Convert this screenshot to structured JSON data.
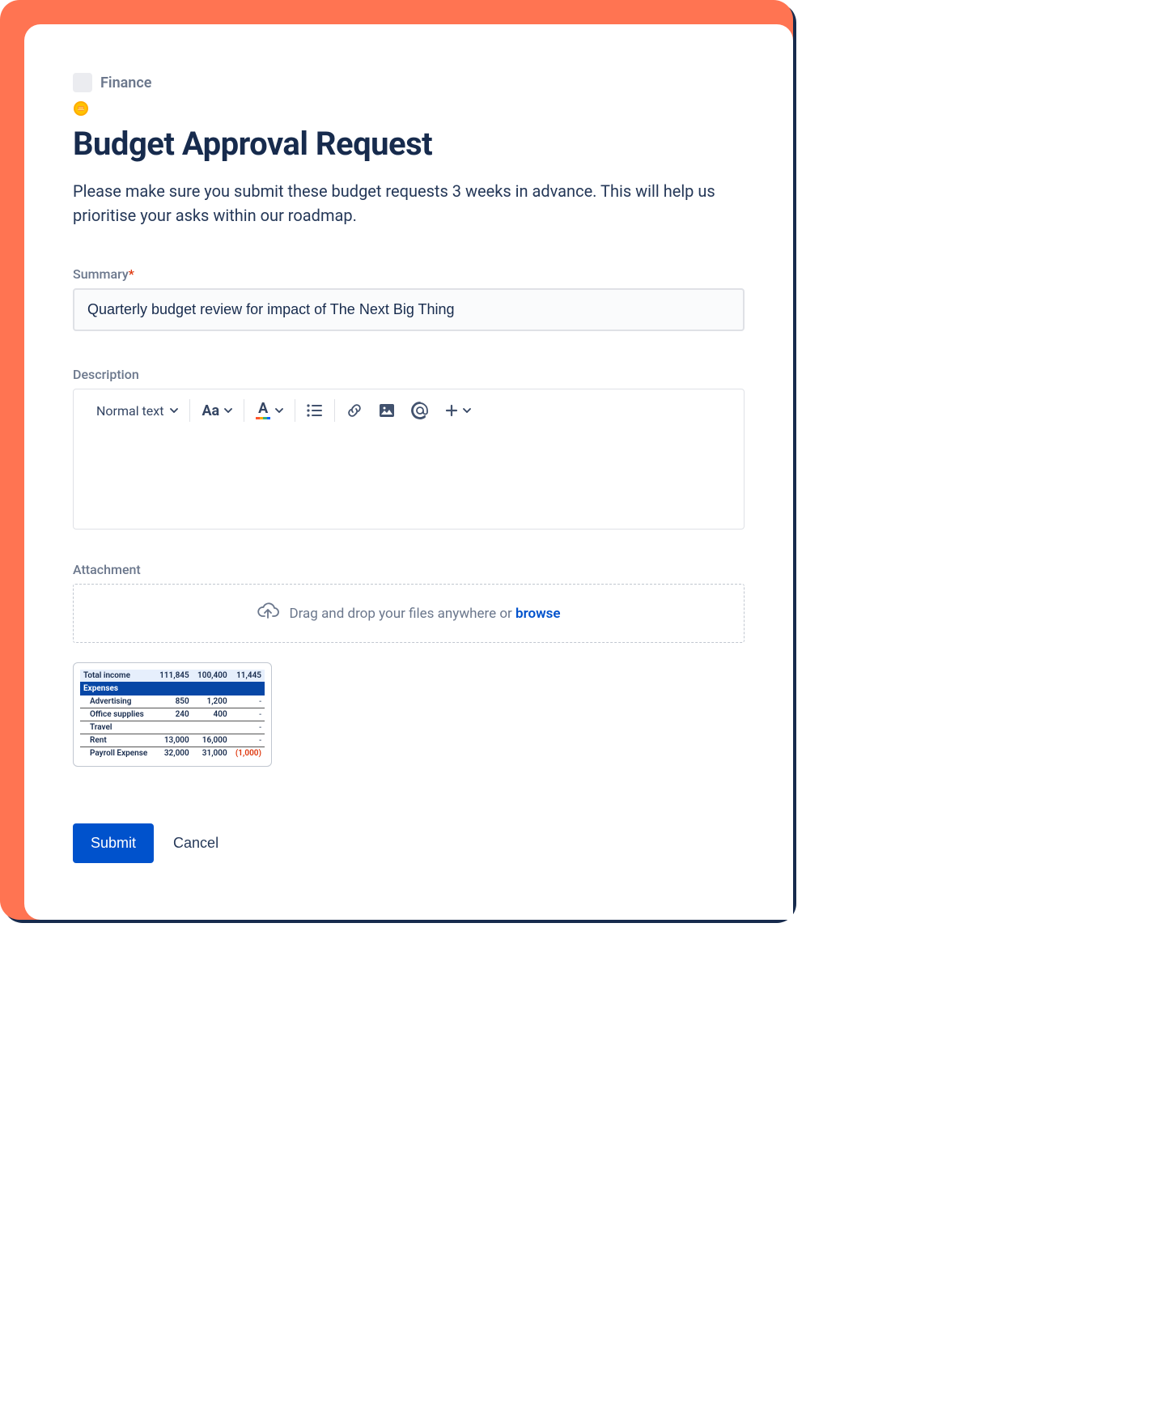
{
  "breadcrumb": {
    "label": "Finance"
  },
  "header": {
    "title": "Budget Approval Request",
    "intro": "Please make sure you submit these budget requests 3 weeks in advance. This will help us prioritise your asks within our roadmap."
  },
  "summary": {
    "label": "Summary",
    "required_mark": "*",
    "value": "Quarterly budget review for impact of The Next Big Thing"
  },
  "description": {
    "label": "Description",
    "toolbar": {
      "style_dropdown": "Normal text"
    }
  },
  "attachment": {
    "label": "Attachment",
    "dropzone_text": "Drag and drop your files anywhere or ",
    "browse": "browse"
  },
  "preview_table": {
    "income": {
      "label": "Total income",
      "c1": "111,845",
      "c2": "100,400",
      "c3": "11,445"
    },
    "expenses_header": "Expenses",
    "rows": [
      {
        "label": "Advertising",
        "c1": "850",
        "c2": "1,200",
        "c3": "-"
      },
      {
        "label": "Office supplies",
        "c1": "240",
        "c2": "400",
        "c3": "-"
      },
      {
        "label": "Travel",
        "c1": "",
        "c2": "",
        "c3": "-"
      },
      {
        "label": "Rent",
        "c1": "13,000",
        "c2": "16,000",
        "c3": "-"
      },
      {
        "label": "Payroll Expense",
        "c1": "32,000",
        "c2": "31,000",
        "c3": "(1,000)",
        "negative": true
      }
    ]
  },
  "actions": {
    "submit": "Submit",
    "cancel": "Cancel"
  }
}
